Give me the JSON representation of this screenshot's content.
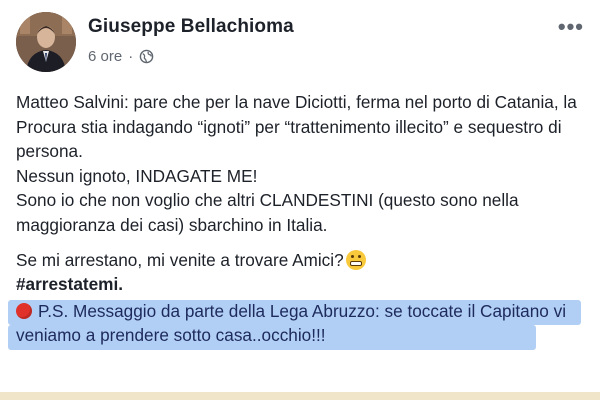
{
  "post": {
    "author": "Giuseppe Bellachioma",
    "time": "6 ore",
    "separator": "·",
    "privacy_icon": "globe-icon",
    "more_label": "•••",
    "paragraphs": {
      "p1": "Matteo Salvini: pare che per la nave Diciotti, ferma nel porto di Catania, la Procura stia indagando “ignoti” per “trattenimento illecito” e sequestro di persona.",
      "p2": "Nessun ignoto, INDAGATE ME!",
      "p3": "Sono io che non voglio che altri CLANDESTINI (questo sono nella maggioranza dei casi) sbarchino in Italia.",
      "p4": "Se mi arrestano, mi venite a trovare Amici?",
      "p5": "#arrestatemi.",
      "ps": "P.S. Messaggio da parte della Lega Abruzzo: se toccate il Capitano vi veniamo a prendere sotto casa..occhio!!!"
    },
    "emoji_icon": "grinning-face-icon",
    "ps_marker_icon": "red-circle-icon",
    "highlight_color": "#a9c9f4"
  }
}
